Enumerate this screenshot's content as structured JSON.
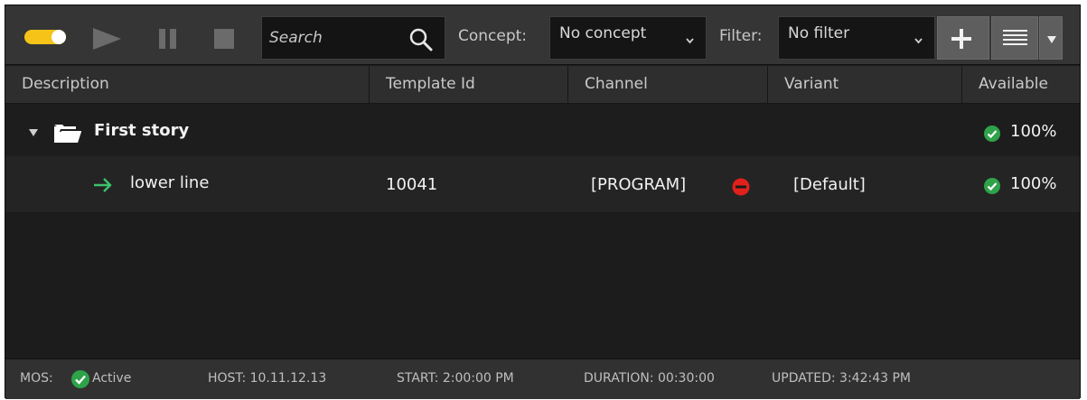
{
  "toolbar": {
    "search": {
      "placeholder": "Search",
      "value": ""
    },
    "concept_label": "Concept:",
    "concept_value": "No concept",
    "filter_label": "Filter:",
    "filter_value": "No filter",
    "icons": [
      "toggle-switch",
      "play-icon",
      "pause-icon",
      "stop-icon",
      "search-icon",
      "chevron-down-icon",
      "plus-icon",
      "list-view-icon",
      "dropdown-arrow-icon"
    ],
    "toggle_on": true
  },
  "columns": [
    "Description",
    "Template Id",
    "Channel",
    "Variant",
    "Available"
  ],
  "rows": [
    {
      "type": "story",
      "description": "First story",
      "available": "100%"
    },
    {
      "type": "item",
      "description": "lower line",
      "template_id": "10041",
      "channel": "[PROGRAM]",
      "variant": "[Default]",
      "available": "100%"
    }
  ],
  "status": {
    "mos_label": "MOS:",
    "mos_state": "Active",
    "host": "HOST: 10.11.12.13",
    "start": "START: 2:00:00 PM",
    "duration": "DURATION: 00:30:00",
    "updated": "UPDATED: 3:42:43 PM"
  },
  "colors": {
    "toggle": "#f6c418",
    "ok_green": "#2ea34a",
    "arrow_green": "#3cc36a",
    "error_red": "#e0211c",
    "panel_bg": "#1c1c1c",
    "toolbar_bg": "#353535"
  }
}
